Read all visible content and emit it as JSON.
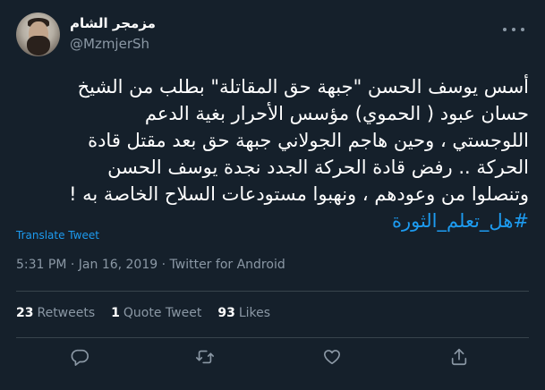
{
  "author": {
    "display_name": "مزمجر الشام",
    "handle": "@MzmjerSh"
  },
  "tweet": {
    "lines": [
      "أسس يوسف الحسن \"جبهة حق المقاتلة\" بطلب من الشيخ",
      "حسان عبود ( الحموي) مؤسس الأحرار بغية الدعم",
      "اللوجستي ، وحين هاجم الجولاني جبهة حق بعد مقتل قادة",
      "الحركة .. رفض قادة الحركة الجدد نجدة يوسف الحسن",
      "وتنصلوا من وعودهم ، ونهبوا مستودعات السلاح الخاصة به !"
    ],
    "hashtag": "#هل_تعلم_الثورة",
    "translate_label": "Translate Tweet",
    "time": "5:31 PM",
    "date": "Jan 16, 2019",
    "source": "Twitter for Android"
  },
  "stats": {
    "retweets_count": "23",
    "retweets_label": "Retweets",
    "quotes_count": "1",
    "quotes_label": "Quote Tweet",
    "likes_count": "93",
    "likes_label": "Likes"
  },
  "icons": {
    "reply": "reply-icon",
    "retweet": "retweet-icon",
    "like": "heart-icon",
    "share": "share-icon",
    "more": "more-icon"
  },
  "colors": {
    "background": "#15202b",
    "accent": "#1d9bf0",
    "secondary_text": "#8b98a5",
    "divider": "#38444d"
  }
}
